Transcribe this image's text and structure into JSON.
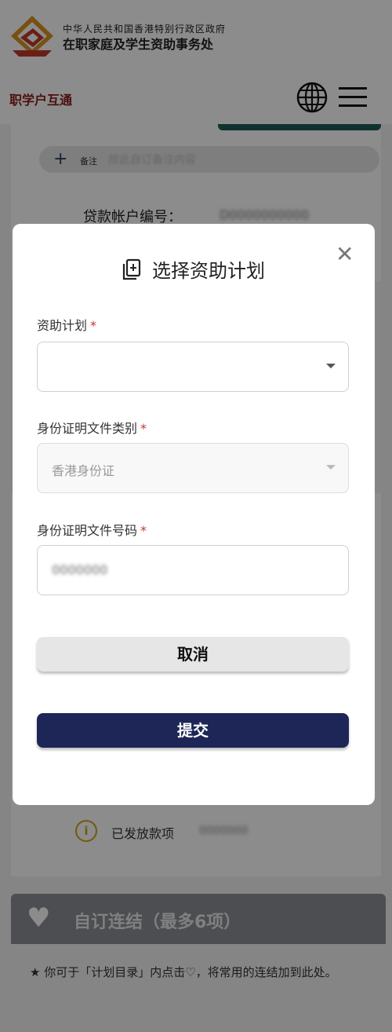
{
  "header": {
    "gov_line1": "中华人民共和国香港特别行政区政府",
    "gov_line2": "在职家庭及学生资助事务处",
    "brand": "职学户互通",
    "logo_icon": "wfsfaa-logo",
    "globe_icon": "globe-icon",
    "menu_icon": "hamburger-menu-icon"
  },
  "background": {
    "notes_label": "备注",
    "notes_placeholder": "按此自订备注内容",
    "account_label": "贷款帐户编号：",
    "account_value": "D0000000000",
    "issued_label": "已发放款项",
    "issued_value": "0000000",
    "favourites_title": "自订连结（最多6项）",
    "favourites_note": "★ 你可于「计划目录」内点击♡，将常用的连结加到此处。"
  },
  "modal": {
    "title": "选择资助计划",
    "fields": [
      {
        "label": "资助计划",
        "required": "*",
        "value": ""
      },
      {
        "label": "身份证明文件类别",
        "required": "*",
        "value": "香港身份证"
      },
      {
        "label": "身份证明文件号码",
        "required": "*",
        "value": "0000000"
      }
    ],
    "cancel_label": "取消",
    "submit_label": "提交"
  },
  "colors": {
    "brand_red": "#8b1a1a",
    "submit_navy": "#1d2657",
    "required_red": "#c0392b",
    "accent_gold": "#d4a017"
  }
}
